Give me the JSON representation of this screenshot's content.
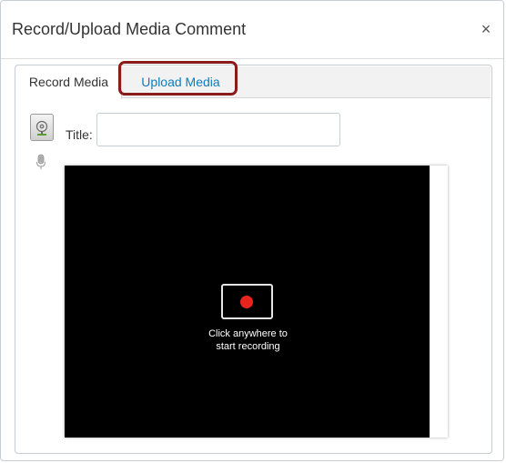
{
  "dialog": {
    "title": "Record/Upload Media Comment",
    "close_glyph": "×",
    "close_icon": "close-icon"
  },
  "tabs": [
    {
      "label": "Record Media",
      "selected": true
    },
    {
      "label": "Upload Media",
      "selected": false
    }
  ],
  "form": {
    "title_label": "Title:",
    "title_value": "",
    "title_placeholder": ""
  },
  "recorder": {
    "record_icon": "record-icon",
    "camera_icon": "webcam-icon",
    "mic_icon": "microphone-icon",
    "hint_line1": "Click anywhere to",
    "hint_line2": "start recording"
  },
  "colors": {
    "link_blue": "#0b7ec0",
    "highlight_outline": "#8a1b1b",
    "record_red": "#e8251c",
    "recorder_bg": "#000000"
  }
}
